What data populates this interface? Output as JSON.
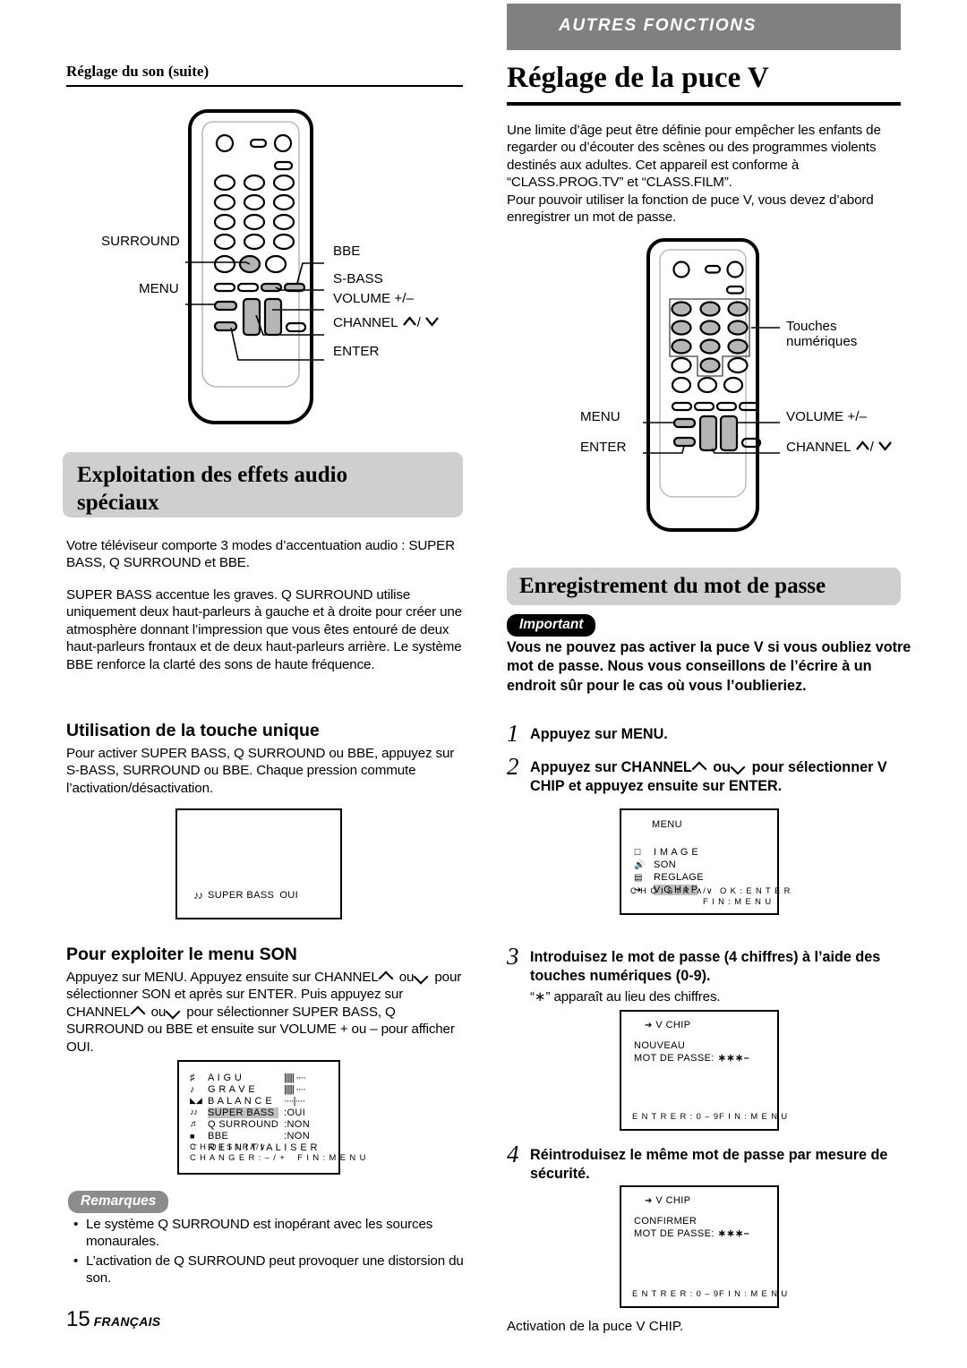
{
  "banner": {
    "label": "AUTRES FONCTIONS"
  },
  "left": {
    "running_head": "Réglage du son (suite)",
    "remote_callouts": {
      "surround": "SURROUND",
      "menu": "MENU",
      "bbe": "BBE",
      "sbass": "S-BASS",
      "volume": "VOLUME +/–",
      "channel": "CHANNEL",
      "enter": "ENTER"
    },
    "heading_audio_line1": "Exploitation des effets audio",
    "heading_audio_line2": "spéciaux",
    "para_audio_1": "Votre téléviseur comporte 3 modes d’accentuation audio : SUPER BASS, Q SURROUND et BBE.",
    "para_audio_2": "SUPER BASS accentue les graves. Q SURROUND utilise uniquement deux haut-parleurs à gauche et à droite pour créer une atmosphère donnant l’impression que vous êtes entouré de deux haut-parleurs frontaux et de deux haut-parleurs arrière. Le système BBE renforce la clarté des sons de haute fréquence.",
    "sub_touche": "Utilisation de la touche unique",
    "para_touche": "Pour activer SUPER BASS, Q SURROUND ou BBE, appuyez sur S-BASS, SURROUND ou BBE.  Chaque pression commute l’activation/désactivation.",
    "osd_superbass": {
      "label": "SUPER BASS",
      "value": "OUI"
    },
    "sub_menuson": "Pour exploiter le menu SON",
    "para_menuson_a": "Appuyez sur MENU.  Appuyez ensuite sur CHANNEL",
    "para_menuson_b": "ou",
    "para_menuson_c": "pour sélectionner SON et après sur ENTER.  Puis appuyez sur CHANNEL",
    "para_menuson_d": "ou",
    "para_menuson_e": "pour sélectionner SUPER BASS, Q SURROUND ou BBE et ensuite sur VOLUME + ou – pour afficher OUI.",
    "osd_son": {
      "rows": [
        {
          "icon": "treble-icon",
          "label": "A I G U",
          "meter": "|||||| ····",
          "value": ""
        },
        {
          "icon": "bass-icon",
          "label": "G R A V E",
          "meter": "|||||| ····",
          "value": ""
        },
        {
          "icon": "balance-icon",
          "label": "B A L A N C E",
          "meter": "····|····",
          "value": ""
        },
        {
          "icon": "superbass-icon",
          "label": "SUPER BASS",
          "meter": "",
          "value": ":OUI"
        },
        {
          "icon": "qsurround-icon",
          "label": "Q SURROUND",
          "meter": "",
          "value": ":NON"
        },
        {
          "icon": "bbe-icon",
          "label": "BBE",
          "meter": "",
          "value": ":NON"
        },
        {
          "icon": "reset-icon",
          "label": "R E I N I T I A L I S E R",
          "meter": "",
          "value": ""
        }
      ],
      "footer_line1": "C H O I S I R",
      "footer_line1_keys": "/",
      "footer_line2": "C H A N G E R : – / +",
      "footer_line3": "F I N : M E N U"
    },
    "remarques_pill": "Remarques",
    "notes": [
      "Le système Q SURROUND est inopérant avec les sources monaurales.",
      "L’activation de Q SURROUND peut provoquer une distorsion du son."
    ],
    "footer_page": "15",
    "footer_lang": "FRANÇAIS"
  },
  "right": {
    "title": "Réglage de la puce V",
    "intro": "Une limite d’âge peut être définie pour empêcher les enfants de regarder ou d’écouter des scènes ou des programmes violents destinés aux adultes. Cet appareil est conforme à “CLASS.PROG.TV” et “CLASS.FILM”.\nPour pouvoir utiliser la fonction de puce V, vous devez d’abord enregistrer un mot de passe.",
    "remote_callouts": {
      "touches_line1": "Touches",
      "touches_line2": "numériques",
      "menu": "MENU",
      "enter": "ENTER",
      "volume": "VOLUME +/–",
      "channel": "CHANNEL"
    },
    "heading_password": "Enregistrement du mot de passe",
    "important_pill": "Important",
    "important_text": "Vous ne pouvez pas activer la puce V si vous oubliez votre mot de passe. Nous vous conseillons de l’écrire à un endroit sûr pour le cas où vous l’oublieriez.",
    "steps": [
      {
        "num": "1",
        "text": "Appuyez sur MENU."
      },
      {
        "num": "2",
        "text_a": "Appuyez sur CHANNEL",
        "text_b": "ou",
        "text_c": "pour sélectionner V CHIP et appuyez ensuite sur ENTER."
      },
      {
        "num": "3",
        "text": "Introduisez le mot de passe (4 chiffres) à l’aide des touches numériques (0-9).",
        "note": "“∗”  apparaît au lieu des chiffres."
      },
      {
        "num": "4",
        "text": "Réintroduisez le même mot de passe par mesure de sécurité."
      }
    ],
    "osd_menu": {
      "title": "MENU",
      "rows": [
        {
          "icon": "image-icon",
          "label": "I M A G E"
        },
        {
          "icon": "sound-icon",
          "label": "SON"
        },
        {
          "icon": "setup-icon",
          "label": "REGLAGE"
        },
        {
          "icon": "vchip-icon",
          "label": "V  C H I P"
        }
      ],
      "footer_line1": "C H O I S I R  :",
      "footer_line1_tail": "O K  :  E N T E R",
      "footer_line2": "F I N  :  M E N U"
    },
    "osd_new": {
      "title": "V  CHIP",
      "line1": "NOUVEAU",
      "line2": "MOT DE PASSE:",
      "stars": "∗∗∗–",
      "footer_left": "E N T R E R : 0 – 9",
      "footer_right": "F I N  :  M E N U"
    },
    "osd_confirm": {
      "title": "V  CHIP",
      "line1": "CONFIRMER",
      "line2": "MOT DE PASSE:",
      "stars": "∗∗∗–",
      "footer_left": "E N T R E R : 0 – 9",
      "footer_right": "F I N  :  M E N U"
    },
    "caption_activation": "Activation de la puce V CHIP."
  },
  "colors": {
    "banner_gray": "#808080",
    "heading_gray": "#cfcfcf",
    "pill_gray": "#8c8c8c",
    "highlight_gray": "#c0c0c0"
  }
}
